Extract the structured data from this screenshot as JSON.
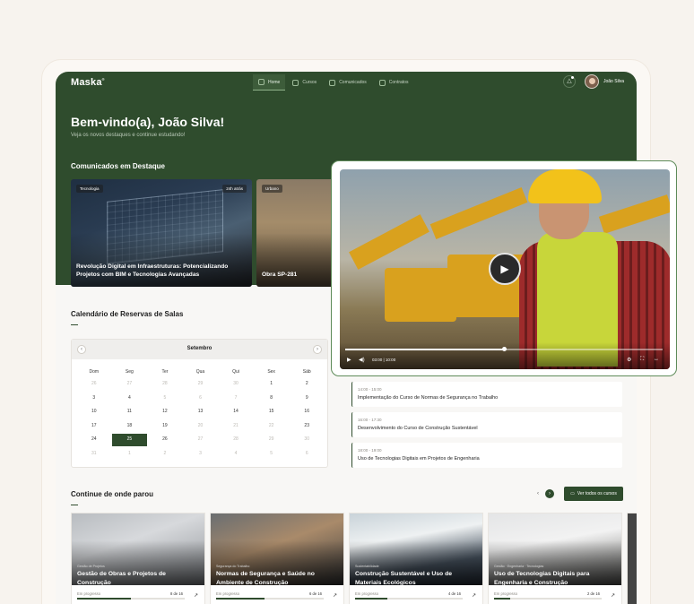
{
  "brand": "Maska",
  "nav": {
    "items": [
      {
        "label": "Home",
        "active": true
      },
      {
        "label": "Cursos",
        "active": false
      },
      {
        "label": "Comunicados",
        "active": false
      },
      {
        "label": "Contratos",
        "active": false
      }
    ],
    "user_name": "João Silva"
  },
  "welcome": {
    "title": "Bem-vindo(a), João Silva!",
    "subtitle": "Veja os novos destaques e continue estudando!"
  },
  "announcements": {
    "section_title": "Comunicados em Destaque",
    "items": [
      {
        "tag": "Tecnologia",
        "time": "24h atrás",
        "title": "Revolução Digital em Infraestruturas: Potencializando Projetos com BIM e Tecnologias Avançadas"
      },
      {
        "tag": "Urbano",
        "title": "Obra SP-281"
      }
    ]
  },
  "calendar": {
    "section_title": "Calendário de Reservas de Salas",
    "month": "Setembro",
    "weekdays": [
      "Dom",
      "Seg",
      "Ter",
      "Qua",
      "Qui",
      "Sex",
      "Sáb"
    ],
    "weeks": [
      [
        "26",
        "27",
        "28",
        "29",
        "30",
        "1",
        "2"
      ],
      [
        "3",
        "4",
        "5",
        "6",
        "7",
        "8",
        "9"
      ],
      [
        "10",
        "11",
        "12",
        "13",
        "14",
        "15",
        "16"
      ],
      [
        "17",
        "18",
        "19",
        "20",
        "21",
        "22",
        "23"
      ],
      [
        "24",
        "25",
        "26",
        "27",
        "28",
        "29",
        "30"
      ],
      [
        "31",
        "1",
        "2",
        "3",
        "4",
        "5",
        "6"
      ]
    ],
    "muted": [
      [
        0,
        0
      ],
      [
        0,
        1
      ],
      [
        0,
        2
      ],
      [
        0,
        3
      ],
      [
        0,
        4
      ],
      [
        1,
        2
      ],
      [
        1,
        3
      ],
      [
        1,
        4
      ],
      [
        3,
        3
      ],
      [
        3,
        4
      ],
      [
        3,
        5
      ],
      [
        4,
        3
      ],
      [
        4,
        4
      ],
      [
        4,
        5
      ],
      [
        4,
        6
      ],
      [
        5,
        0
      ],
      [
        5,
        1
      ],
      [
        5,
        2
      ],
      [
        5,
        3
      ],
      [
        5,
        4
      ],
      [
        5,
        5
      ],
      [
        5,
        6
      ]
    ],
    "selected": [
      4,
      1
    ]
  },
  "events": [
    {
      "time": "14:00 - 15:00",
      "title": "Implementação do Curso de Normas de Segurança no Trabalho"
    },
    {
      "time": "16:00 - 17:30",
      "title": "Desenvolvimento do Curso de Construção Sustentável"
    },
    {
      "time": "18:00 - 19:00",
      "title": "Uso de Tecnologias Digitais em Projetos de Engenharia"
    }
  ],
  "continue": {
    "section_title": "Continue de onde parou",
    "view_all_label": "Ver todos os cursos",
    "courses": [
      {
        "category": "Gestão de Projetos",
        "title": "Gestão de Obras e Projetos de Construção",
        "status": "Em progresso",
        "count": "8 de 16",
        "progress": 0.5
      },
      {
        "category": "Segurança do Trabalho",
        "title": "Normas de Segurança e Saúde no Ambiente de Construção",
        "status": "Em progresso",
        "count": "6 de 16",
        "progress": 0.45
      },
      {
        "category": "Sustentabilidade",
        "title": "Construção Sustentável e Uso de Materiais Ecológicos",
        "status": "Em progresso",
        "count": "4 de 16",
        "progress": 0.3
      },
      {
        "category": "Gestão · Engenharia · Tecnologias",
        "title": "Uso de Tecnologias Digitais para Engenharia e Construção",
        "status": "Em progresso",
        "count": "2 de 16",
        "progress": 0.15
      }
    ]
  },
  "video": {
    "time": "03:00 | 10:00",
    "progress": 0.5
  },
  "colors": {
    "brand_green": "#2f4c2d",
    "accent_green": "#5e8b59"
  }
}
